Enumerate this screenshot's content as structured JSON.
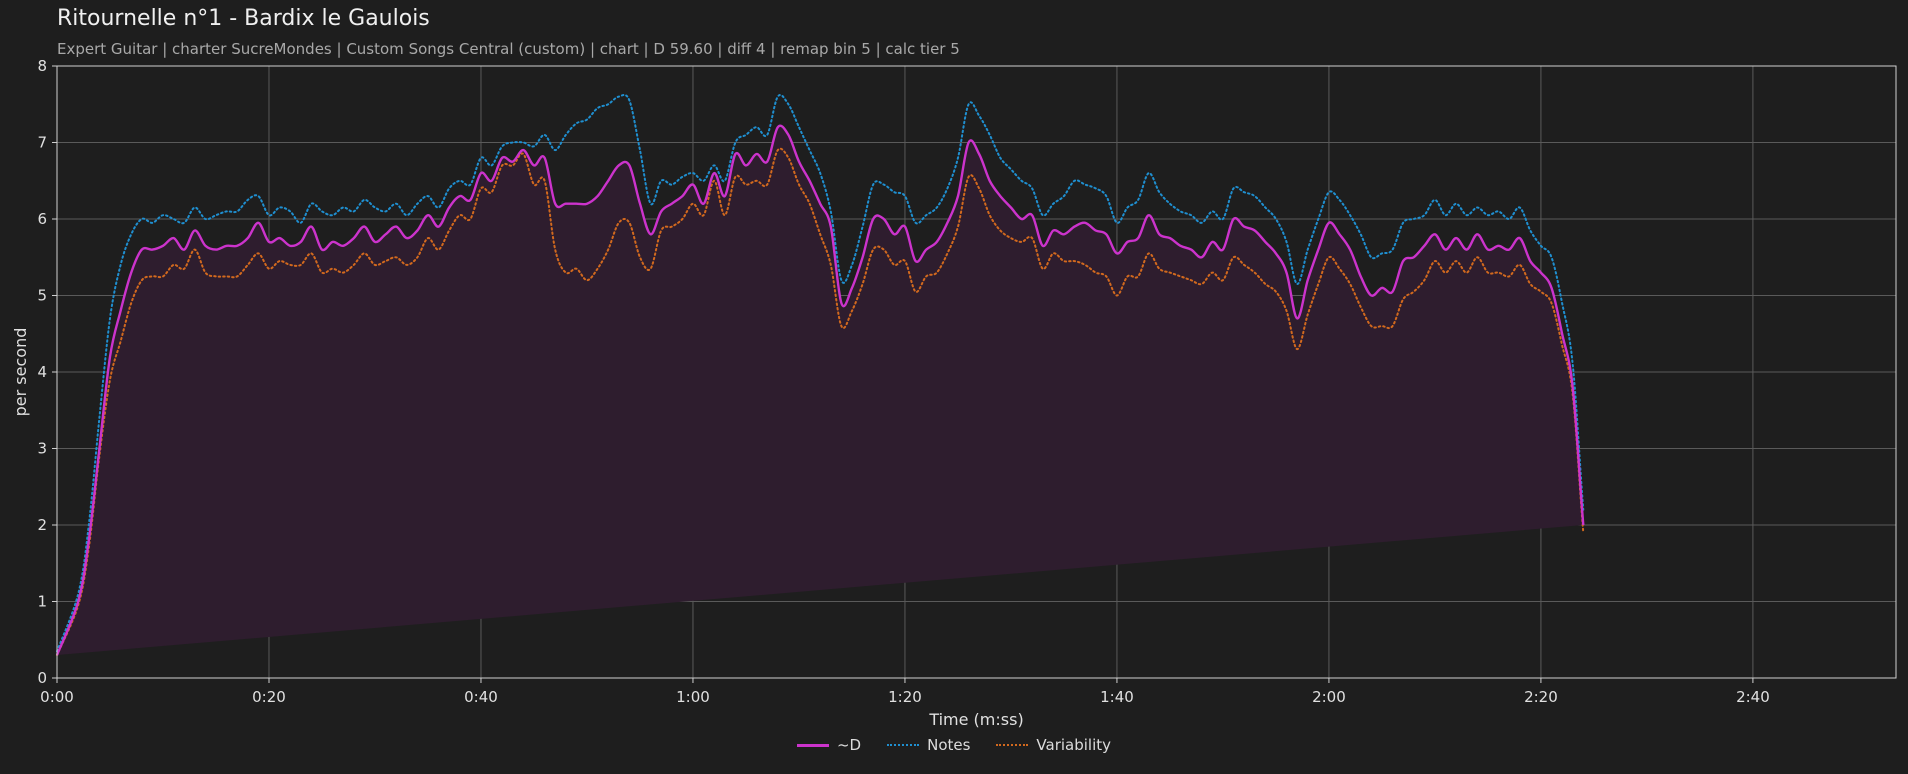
{
  "header": {
    "title": "Ritournelle n°1 - Bardix le Gaulois",
    "subtitle": "Expert Guitar  |  charter SucreMondes  |  Custom Songs Central (custom)  |  chart  |  D 59.60  |  diff 4  |  remap bin 5  |  calc tier 5"
  },
  "chart_data": {
    "type": "line",
    "title": "Ritournelle n°1 - Bardix le Gaulois",
    "xlabel": "Time (m:ss)",
    "ylabel": "per second",
    "xlim": [
      0,
      173.5
    ],
    "ylim": [
      0,
      8
    ],
    "x_ticks": [
      0,
      20,
      40,
      60,
      80,
      100,
      120,
      140,
      160
    ],
    "x_tick_labels": [
      "0:00",
      "0:20",
      "0:40",
      "1:00",
      "1:20",
      "1:40",
      "2:00",
      "2:20",
      "2:40"
    ],
    "y_ticks": [
      0,
      1,
      2,
      3,
      4,
      5,
      6,
      7,
      8
    ],
    "grid": true,
    "legend_position": "bottom-center",
    "x": [
      0,
      2,
      3,
      4,
      5,
      6,
      7,
      8,
      9,
      10,
      11,
      12,
      13,
      14,
      15,
      16,
      17,
      18,
      19,
      20,
      21,
      22,
      23,
      24,
      25,
      26,
      27,
      28,
      29,
      30,
      31,
      32,
      33,
      34,
      35,
      36,
      37,
      38,
      39,
      40,
      41,
      42,
      43,
      44,
      45,
      46,
      47,
      48,
      49,
      50,
      51,
      52,
      53,
      54,
      55,
      56,
      57,
      58,
      59,
      60,
      61,
      62,
      63,
      64,
      65,
      66,
      67,
      68,
      69,
      70,
      71,
      72,
      73,
      74,
      75,
      76,
      77,
      78,
      79,
      80,
      81,
      82,
      83,
      84,
      85,
      86,
      87,
      88,
      89,
      90,
      91,
      92,
      93,
      94,
      95,
      96,
      97,
      98,
      99,
      100,
      101,
      102,
      103,
      104,
      105,
      106,
      107,
      108,
      109,
      110,
      111,
      112,
      113,
      114,
      115,
      116,
      117,
      118,
      119,
      120,
      121,
      122,
      123,
      124,
      125,
      126,
      127,
      128,
      129,
      130,
      131,
      132,
      133,
      134,
      135,
      136,
      137,
      138,
      139,
      140,
      141,
      142,
      143,
      144,
      145,
      146,
      147,
      148,
      149,
      150,
      151,
      152,
      153,
      154,
      155,
      156,
      157,
      158,
      159,
      160,
      161,
      162,
      163,
      164,
      165,
      166,
      167,
      168,
      169,
      170,
      171,
      172,
      173,
      173.5
    ],
    "series": [
      {
        "name": "~D",
        "color": "#cc33cc",
        "style": "solid",
        "fill": "#2e1d2e",
        "values": [
          0.3,
          1.0,
          1.8,
          3.0,
          4.2,
          4.8,
          5.3,
          5.6,
          5.6,
          5.65,
          5.75,
          5.6,
          5.85,
          5.65,
          5.6,
          5.65,
          5.65,
          5.75,
          5.95,
          5.7,
          5.75,
          5.65,
          5.7,
          5.9,
          5.6,
          5.7,
          5.65,
          5.75,
          5.9,
          5.7,
          5.8,
          5.9,
          5.75,
          5.85,
          6.05,
          5.9,
          6.15,
          6.3,
          6.25,
          6.6,
          6.5,
          6.8,
          6.75,
          6.9,
          6.7,
          6.8,
          6.2,
          6.2,
          6.2,
          6.2,
          6.3,
          6.5,
          6.7,
          6.7,
          6.2,
          5.8,
          6.1,
          6.2,
          6.3,
          6.45,
          6.2,
          6.6,
          6.3,
          6.85,
          6.7,
          6.85,
          6.75,
          7.2,
          7.1,
          6.75,
          6.5,
          6.2,
          5.9,
          4.9,
          5.1,
          5.5,
          6.0,
          6.0,
          5.8,
          5.9,
          5.45,
          5.6,
          5.7,
          5.95,
          6.3,
          7.0,
          6.85,
          6.5,
          6.3,
          6.15,
          6.0,
          6.05,
          5.65,
          5.85,
          5.8,
          5.9,
          5.95,
          5.85,
          5.8,
          5.55,
          5.7,
          5.75,
          6.05,
          5.8,
          5.75,
          5.65,
          5.6,
          5.5,
          5.7,
          5.6,
          6.0,
          5.9,
          5.85,
          5.7,
          5.55,
          5.3,
          4.7,
          5.2,
          5.6,
          5.95,
          5.8,
          5.6,
          5.25,
          5.0,
          5.1,
          5.05,
          5.45,
          5.5,
          5.65,
          5.8,
          5.6,
          5.75,
          5.6,
          5.8,
          5.6,
          5.65,
          5.6,
          5.75,
          5.45,
          5.3,
          5.1,
          4.5,
          3.8,
          2.0,
          0.5
        ],
        "x_index_note": ""
      },
      {
        "name": "Notes",
        "color": "#1f8fd0",
        "style": "dotted",
        "values": [
          0.35,
          1.1,
          2.0,
          3.4,
          4.7,
          5.4,
          5.8,
          6.0,
          5.95,
          6.05,
          6.0,
          5.95,
          6.15,
          6.0,
          6.05,
          6.1,
          6.1,
          6.25,
          6.3,
          6.05,
          6.15,
          6.1,
          5.95,
          6.2,
          6.1,
          6.05,
          6.15,
          6.1,
          6.25,
          6.15,
          6.1,
          6.2,
          6.05,
          6.2,
          6.3,
          6.15,
          6.4,
          6.5,
          6.45,
          6.8,
          6.7,
          6.95,
          7.0,
          7.0,
          6.95,
          7.1,
          6.9,
          7.1,
          7.25,
          7.3,
          7.45,
          7.5,
          7.6,
          7.55,
          6.9,
          6.2,
          6.5,
          6.45,
          6.55,
          6.6,
          6.5,
          6.7,
          6.5,
          7.0,
          7.1,
          7.2,
          7.1,
          7.6,
          7.5,
          7.2,
          6.9,
          6.6,
          6.1,
          5.2,
          5.4,
          5.9,
          6.45,
          6.45,
          6.35,
          6.3,
          5.95,
          6.05,
          6.15,
          6.4,
          6.8,
          7.5,
          7.35,
          7.1,
          6.8,
          6.65,
          6.5,
          6.4,
          6.05,
          6.2,
          6.3,
          6.5,
          6.45,
          6.4,
          6.3,
          5.95,
          6.15,
          6.25,
          6.6,
          6.35,
          6.2,
          6.1,
          6.05,
          5.95,
          6.1,
          6.0,
          6.4,
          6.35,
          6.3,
          6.15,
          6.0,
          5.7,
          5.15,
          5.6,
          6.0,
          6.35,
          6.25,
          6.05,
          5.8,
          5.5,
          5.55,
          5.6,
          5.95,
          6.0,
          6.05,
          6.25,
          6.05,
          6.2,
          6.05,
          6.15,
          6.05,
          6.1,
          6.0,
          6.15,
          5.85,
          5.65,
          5.5,
          4.9,
          4.1,
          2.2,
          0.6
        ]
      },
      {
        "name": "Variability",
        "color": "#d2691e",
        "style": "dotted",
        "values": [
          0.3,
          0.95,
          1.7,
          2.9,
          3.9,
          4.4,
          4.9,
          5.2,
          5.25,
          5.25,
          5.4,
          5.35,
          5.6,
          5.3,
          5.25,
          5.25,
          5.25,
          5.4,
          5.55,
          5.35,
          5.45,
          5.4,
          5.4,
          5.55,
          5.3,
          5.35,
          5.3,
          5.4,
          5.55,
          5.4,
          5.45,
          5.5,
          5.4,
          5.5,
          5.75,
          5.6,
          5.85,
          6.05,
          6.0,
          6.4,
          6.35,
          6.7,
          6.7,
          6.85,
          6.45,
          6.5,
          5.6,
          5.3,
          5.35,
          5.2,
          5.35,
          5.6,
          5.95,
          5.95,
          5.5,
          5.35,
          5.85,
          5.9,
          6.0,
          6.2,
          6.05,
          6.5,
          6.05,
          6.55,
          6.45,
          6.5,
          6.45,
          6.9,
          6.8,
          6.45,
          6.2,
          5.8,
          5.4,
          4.6,
          4.8,
          5.15,
          5.6,
          5.6,
          5.4,
          5.45,
          5.05,
          5.25,
          5.3,
          5.55,
          5.9,
          6.55,
          6.4,
          6.05,
          5.85,
          5.75,
          5.7,
          5.75,
          5.35,
          5.55,
          5.45,
          5.45,
          5.4,
          5.3,
          5.25,
          5.0,
          5.25,
          5.25,
          5.55,
          5.35,
          5.3,
          5.25,
          5.2,
          5.15,
          5.3,
          5.2,
          5.5,
          5.4,
          5.3,
          5.15,
          5.05,
          4.8,
          4.3,
          4.75,
          5.15,
          5.5,
          5.35,
          5.15,
          4.85,
          4.6,
          4.6,
          4.6,
          4.95,
          5.05,
          5.2,
          5.45,
          5.3,
          5.45,
          5.3,
          5.5,
          5.3,
          5.3,
          5.25,
          5.4,
          5.15,
          5.05,
          4.9,
          4.35,
          3.7,
          1.9,
          0.5
        ]
      }
    ]
  }
}
